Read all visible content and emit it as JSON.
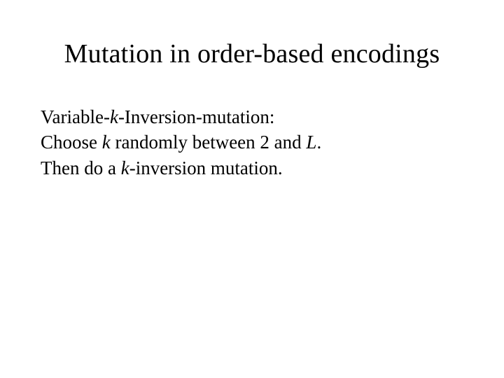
{
  "slide": {
    "title": "Mutation in order-based encodings",
    "line1_pre": "Variable-",
    "line1_k": "k",
    "line1_post": "-Inversion-mutation:",
    "line2_pre": "Choose ",
    "line2_k": "k",
    "line2_mid": " randomly between 2 and ",
    "line2_L": "L",
    "line2_post": ".",
    "line3_pre": "Then do a ",
    "line3_k": "k",
    "line3_post": "-inversion mutation."
  }
}
